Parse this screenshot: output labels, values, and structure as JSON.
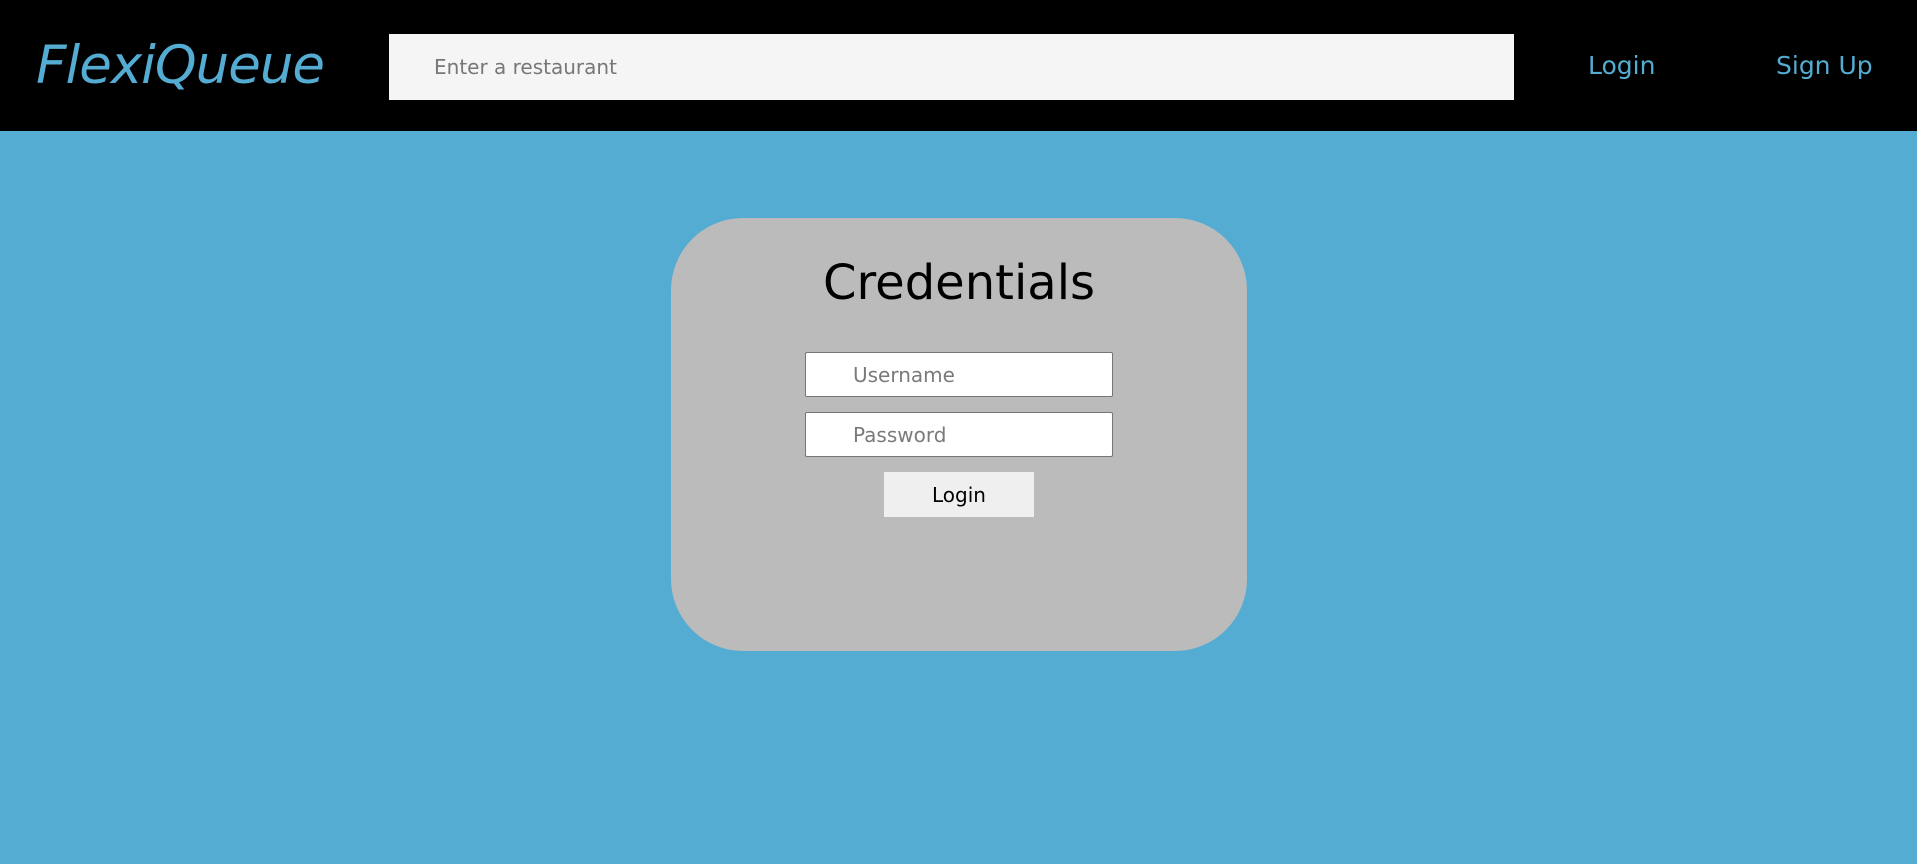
{
  "header": {
    "brand": "FlexiQueue",
    "search": {
      "placeholder": "Enter a restaurant",
      "value": ""
    },
    "nav": {
      "login_label": "Login",
      "signup_label": "Sign Up"
    }
  },
  "credentials": {
    "title": "Credentials",
    "username": {
      "placeholder": "Username",
      "value": ""
    },
    "password": {
      "placeholder": "Password",
      "value": ""
    },
    "submit_label": "Login"
  },
  "colors": {
    "header_bg": "#000000",
    "page_bg": "#54acd2",
    "accent": "#54acd2",
    "card_bg": "#bbbbbb",
    "search_bg": "#f5f5f5",
    "button_bg": "#efefef"
  }
}
